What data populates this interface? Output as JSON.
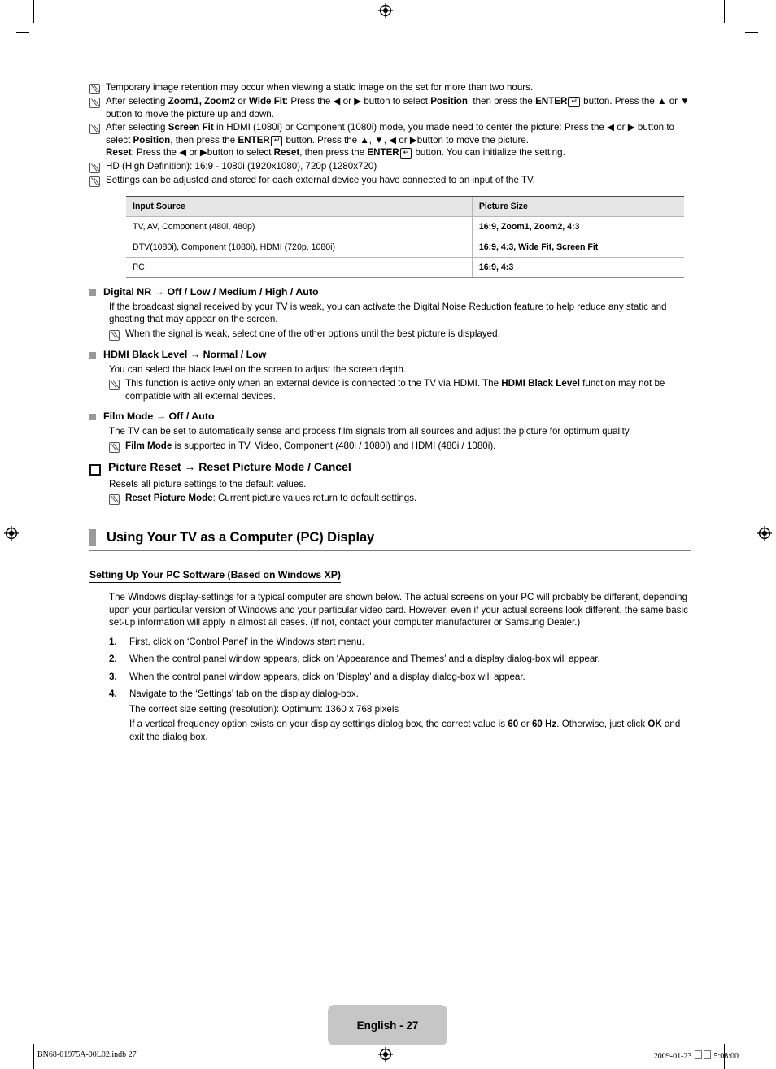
{
  "document": {
    "page_badge": "English - 27",
    "footer_left": "BN68-01975A-00L02.indb   27",
    "footer_date": "2009-01-23",
    "footer_time": "5:08:00"
  },
  "top_notes": [
    {
      "id": "note-retention",
      "html": "Temporary image retention may occur when viewing a static image on the set for more than two hours."
    },
    {
      "id": "note-zoom",
      "html": "After selecting <b>Zoom1, Zoom2</b> or <b>Wide Fit</b>: Press the ◀ or ▶ button to select <b>Position</b>, then press the <b>ENTER</b><span class=\"enter-key\">↵</span> button. Press the ▲ or ▼ button to move the picture up and down."
    },
    {
      "id": "note-screenfit",
      "html": "After selecting <b>Screen Fit</b> in HDMI (1080i) or Component (1080i) mode, you made need to center the picture: Press the ◀ or ▶ button to select <b>Position</b>, then press the <b>ENTER</b><span class=\"enter-key\">↵</span> button. Press the ▲, ▼, ◀ or ▶button to move the picture.<br><b>Reset</b>: Press the ◀ or ▶button to select <b>Reset</b>, then press the <b>ENTER</b><span class=\"enter-key\">↵</span> button. You can initialize the setting."
    },
    {
      "id": "note-hd",
      "html": "HD (High Definition): 16:9 - 1080i (1920x1080), 720p (1280x720)"
    },
    {
      "id": "note-settings-stored",
      "html": "Settings can be adjusted and stored for each external device you have connected to an input of the TV."
    }
  ],
  "table": {
    "headers": [
      "Input Source",
      "Picture Size"
    ],
    "rows": [
      [
        "TV, AV, Component (480i, 480p)",
        "16:9, Zoom1, Zoom2, 4:3"
      ],
      [
        "DTV(1080i), Component (1080i), HDMI (720p, 1080i)",
        "16:9, 4:3, Wide Fit, Screen Fit"
      ],
      [
        "PC",
        "16:9, 4:3"
      ]
    ]
  },
  "settings": [
    {
      "id": "digital-nr",
      "bullet": "square",
      "heading": "Digital NR → Off / Low / Medium / High / Auto",
      "body": "If the broadcast signal received by your TV is weak, you can activate the Digital Noise Reduction feature to help reduce any static and ghosting that may appear on the screen.",
      "notes": [
        "When the signal is weak, select one of the other options until the best picture is displayed."
      ]
    },
    {
      "id": "hdmi-black-level",
      "bullet": "square",
      "heading": "HDMI Black Level → Normal / Low",
      "body": "You can select the black level on the screen to adjust the screen depth.",
      "notes": [
        "This function is active only when an external device is connected to the TV via HDMI. The <b>HDMI Black Level</b> function may not be compatible with all external devices."
      ]
    },
    {
      "id": "film-mode",
      "bullet": "square",
      "heading": "Film Mode → Off / Auto",
      "body": "The TV can be set to automatically sense and process film signals from all sources and adjust the picture for optimum quality.",
      "notes": [
        "<b>Film Mode</b> is supported in TV, Video, Component (480i / 1080i) and HDMI (480i / 1080i)."
      ]
    },
    {
      "id": "picture-reset",
      "bullet": "hollow",
      "heading": "Picture Reset → Reset Picture Mode / Cancel",
      "body": "Resets all picture settings to the default values.",
      "notes": [
        "<b>Reset Picture Mode</b>: Current picture values return to default settings."
      ]
    }
  ],
  "section": {
    "title": "Using Your TV as a Computer (PC) Display",
    "sub_heading": "Setting Up Your PC Software (Based on Windows XP)",
    "intro": "The Windows display-settings for a typical computer are shown below. The actual screens on your PC will probably be different, depending upon your particular version of Windows and your particular video card. However, even if your actual screens look different, the same basic set-up information will apply in almost all cases. (If not, contact your computer manufacturer or Samsung Dealer.)",
    "steps": [
      {
        "num": "1.",
        "lines": [
          "First, click on ‘Control Panel’ in the Windows start menu."
        ]
      },
      {
        "num": "2.",
        "lines": [
          "When the control panel window appears, click on ‘Appearance and Themes’ and a display dialog-box will appear."
        ]
      },
      {
        "num": "3.",
        "lines": [
          "When the control panel window appears, click on ‘Display’ and a display dialog-box will appear."
        ]
      },
      {
        "num": "4.",
        "lines": [
          "Navigate to the ‘Settings’ tab on the display dialog-box.",
          "The correct size setting (resolution): Optimum: 1360 x 768 pixels",
          "If a vertical frequency option exists on your display settings dialog box, the correct value is <b>60</b> or <b>60 Hz</b>. Otherwise, just click <b>OK</b> and exit the dialog box."
        ]
      }
    ]
  },
  "colors": {
    "bullet_gray": "#9a9a9a",
    "table_header_bg": "#e6e6e6",
    "badge_bg": "#c6c6c6"
  }
}
